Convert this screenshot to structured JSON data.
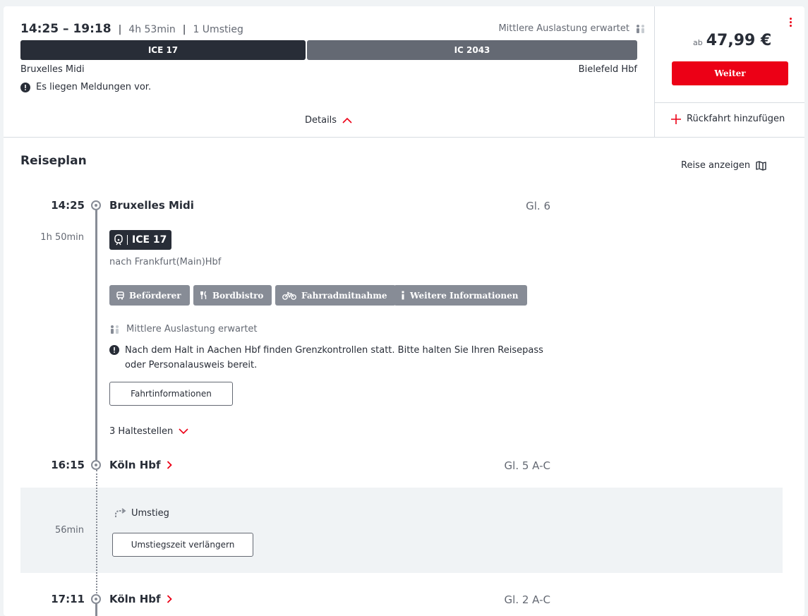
{
  "summary": {
    "times": "14:25 – 19:18",
    "duration": "4h 53min",
    "transfers": "1 Umstieg",
    "occupancy": "Mittlere Auslastung erwartet",
    "trains": [
      "ICE 17",
      "IC 2043"
    ],
    "from": "Bruxelles Midi",
    "to": "Bielefeld Hbf",
    "notice": "Es liegen Meldungen vor.",
    "details_label": "Details"
  },
  "price": {
    "prefix": "ab",
    "amount": "47,99 €",
    "button": "Weiter",
    "return_label": "Rückfahrt hinzufügen"
  },
  "itinerary": {
    "title": "Reiseplan",
    "map_link": "Reise anzeigen",
    "stops": [
      {
        "time": "14:25",
        "name": "Bruxelles Midi",
        "track": "Gl. 6"
      },
      {
        "time": "16:15",
        "name": "Köln Hbf",
        "track": "Gl. 5 A-C"
      },
      {
        "time": "17:11",
        "name": "Köln Hbf",
        "track": "Gl. 2 A-C"
      }
    ],
    "leg": {
      "duration": "1h 50min",
      "train": "ICE 17",
      "direction": "nach Frankfurt(Main)Hbf",
      "chips": [
        "Beförderer",
        "Bordbistro",
        "Fahrradmitnahme",
        "Weitere Informationen"
      ],
      "occupancy": "Mittlere Auslastung erwartet",
      "notice_line1": "Nach dem Halt in Aachen Hbf finden Grenzkontrollen statt. Bitte halten Sie Ihren Reisepass",
      "notice_line2": "oder Personalausweis bereit.",
      "info_button": "Fahrtinformationen",
      "stops_toggle": "3 Haltestellen"
    },
    "transfer": {
      "duration": "56min",
      "label": "Umstieg",
      "button": "Umstiegszeit verlängern"
    }
  },
  "colors": {
    "accent": "#ec0016",
    "dark": "#282d37",
    "gray": "#646973",
    "chip": "#878c96"
  }
}
